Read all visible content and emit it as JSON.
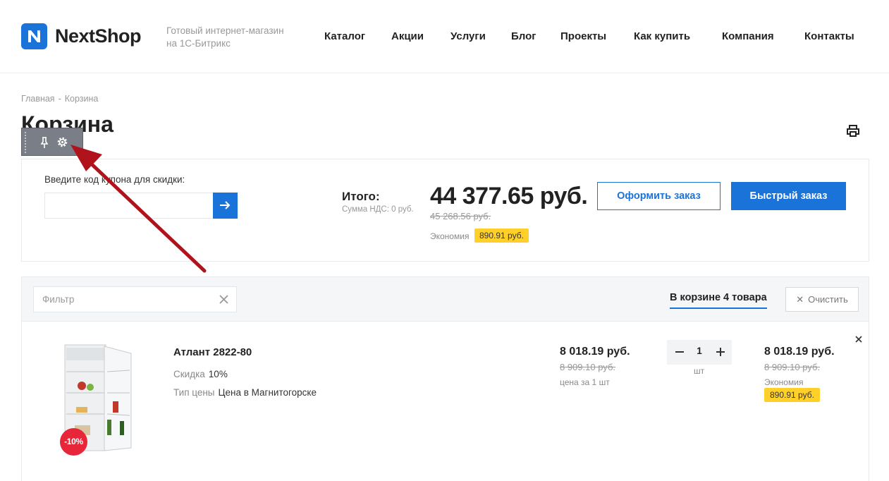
{
  "header": {
    "logo_text": "NextShop",
    "tagline": "Готовый интернет-магазин на 1С-Битрикс",
    "nav": [
      "Каталог",
      "Акции",
      "Услуги",
      "Блог",
      "Проекты",
      "Как купить",
      "Компания",
      "Контакты"
    ]
  },
  "breadcrumb": {
    "home": "Главная",
    "separator": "-",
    "current": "Корзина"
  },
  "page_title": "Корзина",
  "coupon": {
    "label": "Введите код купона для скидки:",
    "value": ""
  },
  "summary": {
    "total_label": "Итого:",
    "vat_label": "Сумма НДС: 0 руб.",
    "total": "44 377.65 руб.",
    "total_old": "45 268.56 руб.",
    "economy_label": "Экономия",
    "economy_value": "890.91 руб.",
    "checkout_label": "Оформить заказ",
    "quick_order_label": "Быстрый заказ"
  },
  "cart_toolbar": {
    "filter_placeholder": "Фильтр",
    "count_label": "В корзине 4 товара",
    "clear_label": "Очистить"
  },
  "items": [
    {
      "name": "Атлант 2822-80",
      "discount_badge": "-10%",
      "props": [
        {
          "key": "Скидка",
          "value": "10%"
        },
        {
          "key": "Тип цены",
          "value": "Цена в Магнитогорске"
        }
      ],
      "price": "8 018.19 руб.",
      "price_old": "8 909.10 руб.",
      "price_note": "цена за 1 шт",
      "quantity": "1",
      "unit": "шт",
      "sum": "8 018.19 руб.",
      "sum_old": "8 909.10 руб.",
      "economy_label": "Экономия",
      "economy_value": "890.91 руб."
    }
  ],
  "icons": {
    "brand_color": "#1a73d9",
    "badge_color": "#ffd02a",
    "discount_color": "#e8263a",
    "annotation_color": "#b0131b"
  }
}
